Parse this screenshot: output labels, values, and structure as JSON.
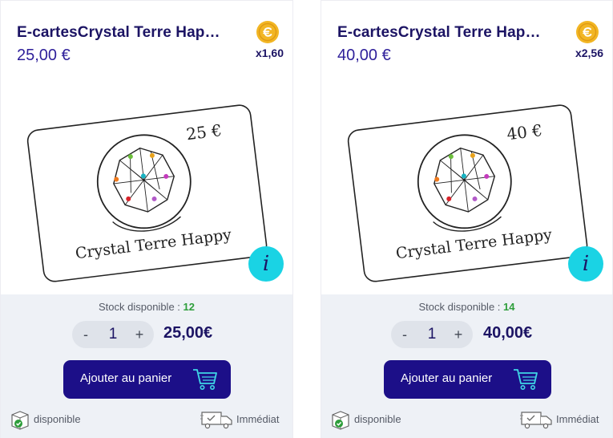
{
  "products": [
    {
      "title": "E-cartesCrystal Terre Hap…",
      "price": "25,00 €",
      "multiplier": "x1,60",
      "card_amount": "25 €",
      "card_brand": "Crystal Terre Happy",
      "info_label": "i",
      "stock_label": "Stock disponible :",
      "stock_count": "12",
      "qty_minus": "-",
      "qty_value": "1",
      "qty_plus": "+",
      "total": "25,00€",
      "add_to_cart": "Ajouter au panier",
      "availability": "disponible",
      "delivery": "Immédiat"
    },
    {
      "title": "E-cartesCrystal Terre Hap…",
      "price": "40,00 €",
      "multiplier": "x2,56",
      "card_amount": "40 €",
      "card_brand": "Crystal Terre Happy",
      "info_label": "i",
      "stock_label": "Stock disponible :",
      "stock_count": "14",
      "qty_minus": "-",
      "qty_value": "1",
      "qty_plus": "+",
      "total": "40,00€",
      "add_to_cart": "Ajouter au panier",
      "availability": "disponible",
      "delivery": "Immédiat"
    }
  ],
  "icons": {
    "coin": "coin-icon",
    "info": "info-icon",
    "cart": "cart-icon",
    "availability": "box-check-icon",
    "delivery": "truck-icon"
  },
  "colors": {
    "brand_dark": "#1c1464",
    "button_bg": "#1c0f88",
    "info_bg": "#1ad3e4",
    "stock_ok": "#2e9e3b",
    "coin": "#f2b624",
    "panel_bg": "#eef1f6"
  }
}
